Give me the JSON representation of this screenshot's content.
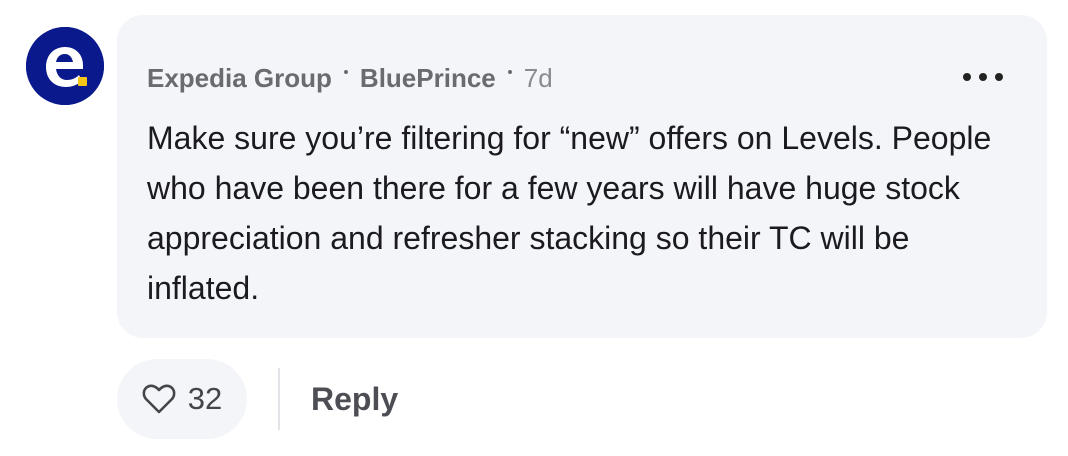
{
  "comment": {
    "company": "Expedia Group",
    "username": "BluePrince",
    "age": "7d",
    "body": "Make sure you’re filtering for “new” offers on Levels. People who have been there for a few years will have huge stock appreciation and refresher stacking so their TC will be inflated."
  },
  "actions": {
    "like_count": "32",
    "reply_label": "Reply"
  },
  "icons": {
    "avatar": "expedia-logo",
    "more": "more-horizontal-icon",
    "like": "heart-icon"
  },
  "colors": {
    "avatar_bg": "#0a1a8c",
    "bubble_bg": "#f4f5f8"
  }
}
